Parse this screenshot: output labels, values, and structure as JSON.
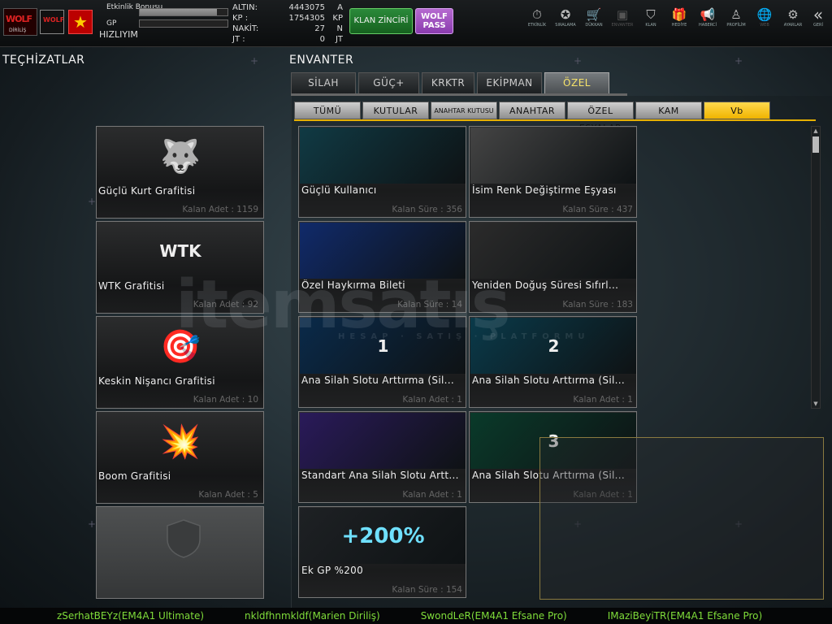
{
  "topbar": {
    "logo_text": "WOLF",
    "logo_sub": "DİRİLİŞ",
    "bonus_label": "Etkinlik Bonusu",
    "gp_label": "GP",
    "status": "HIZLIYIM",
    "bars": {
      "bonus_fill": 0.88,
      "gp_fill": 0.0
    },
    "currency": [
      {
        "label": "ALTIN:",
        "value": "4443075",
        "unit": "A"
      },
      {
        "label": "KP  :",
        "value": "1754305",
        "unit": "KP"
      },
      {
        "label": "NAKİT:",
        "value": "27",
        "unit": "N"
      },
      {
        "label": "JT  :",
        "value": "0",
        "unit": "JT"
      }
    ],
    "klan_button": "KLAN ZİNCİRİ",
    "wolf_pass": "WOLF PASS",
    "nav": [
      {
        "label": "ETKİNLİK",
        "icon": "stopwatch-icon",
        "glyph": "⏱",
        "dim": false
      },
      {
        "label": "SIRALAMA",
        "icon": "medal-icon",
        "glyph": "✪",
        "dim": false
      },
      {
        "label": "DÜKKAN",
        "icon": "cart-icon",
        "glyph": "🛒",
        "dim": false
      },
      {
        "label": "ENVANTER",
        "icon": "chest-icon",
        "glyph": "▣",
        "dim": true
      },
      {
        "label": "KLAN",
        "icon": "shield-icon",
        "glyph": "⛉",
        "dim": false
      },
      {
        "label": "HEDİYE",
        "icon": "gift-icon",
        "glyph": "🎁",
        "dim": false
      },
      {
        "label": "HABERCİ",
        "icon": "megaphone-icon",
        "glyph": "📢",
        "dim": false
      },
      {
        "label": "PROFİLİM",
        "icon": "profile-icon",
        "glyph": "♙",
        "dim": false
      },
      {
        "label": "WEB",
        "icon": "globe-icon",
        "glyph": "🌐",
        "dim": true
      },
      {
        "label": "AYARLAR",
        "icon": "gear-icon",
        "glyph": "⚙",
        "dim": false
      },
      {
        "label": "GERİ",
        "icon": "back-icon",
        "glyph": "«",
        "dim": false
      }
    ]
  },
  "left_title": "TEÇHİZATLAR",
  "right_title": "ENVANTER",
  "main_tabs": [
    {
      "label": "SİLAH",
      "active": false
    },
    {
      "label": "GÜÇ+",
      "active": false
    },
    {
      "label": "KRKTR",
      "active": false
    },
    {
      "label": "EKİPMAN",
      "active": false
    },
    {
      "label": "ÖZEL",
      "active": true
    }
  ],
  "sub_tabs": [
    {
      "label": "TÜMÜ",
      "active": false,
      "small": false
    },
    {
      "label": "KUTULAR",
      "active": false,
      "small": false
    },
    {
      "label": "ANAHTAR KUTUSU",
      "active": false,
      "small": true
    },
    {
      "label": "ANAHTAR",
      "active": false,
      "small": false
    },
    {
      "label": "ÖZEL EŞYALAR",
      "active": false,
      "small": false
    },
    {
      "label": "KAM",
      "active": false,
      "small": false
    },
    {
      "label": "Vb",
      "active": true,
      "small": false
    }
  ],
  "equipment": [
    {
      "name": "Güçlü Kurt Grafitisi",
      "sub": "Kalan Adet : 1159",
      "icon": "wolf-graffiti-icon",
      "glyph": "🐺"
    },
    {
      "name": "WTK Grafitisi",
      "sub": "Kalan Adet : 92",
      "icon": "wtk-logo-icon",
      "glyph": "WTK"
    },
    {
      "name": "Keskin Nişancı Grafitisi",
      "sub": "Kalan Adet : 10",
      "icon": "sniper-graffiti-icon",
      "glyph": "🎯"
    },
    {
      "name": "Boom Grafitisi",
      "sub": "Kalan Adet : 5",
      "icon": "boom-graffiti-icon",
      "glyph": "💥"
    }
  ],
  "empty_slot_icon": "empty-slot-shield-icon",
  "inventory_items": [
    {
      "name": "Güçlü Kullanıcı",
      "sub": "Kalan Süre : 356",
      "icon": "power-user-icon",
      "art_color": "#103a44"
    },
    {
      "name": "İsim Renk Değiştirme Eşyası",
      "sub": "Kalan Süre : 437",
      "icon": "name-color-icon",
      "art_color": "#444"
    },
    {
      "name": "Özel Haykırma Bileti",
      "sub": "Kalan Süre : 14",
      "icon": "shout-ticket-icon",
      "art_color": "#102a6a"
    },
    {
      "name": "Yeniden Doğuş Süresi Sıfırl...",
      "sub": "Kalan Süre : 183",
      "icon": "respawn-reset-icon",
      "art_color": "#2b2b2b"
    },
    {
      "name": "Ana Silah Slotu Arttırma (Sil...",
      "sub": "Kalan Adet : 1",
      "icon": "weapon-slot-1-icon",
      "art_color": "#0a2a4a",
      "badge": "1"
    },
    {
      "name": "Ana Silah Slotu Arttırma (Sil...",
      "sub": "Kalan Adet : 1",
      "icon": "weapon-slot-2-icon",
      "art_color": "#0a3a4a",
      "badge": "2"
    },
    {
      "name": "Standart Ana Silah Slotu Artt...",
      "sub": "Kalan Adet : 1",
      "icon": "weapon-slot-std-icon",
      "art_color": "#2a1a5a"
    },
    {
      "name": "Ana Silah Slotu Arttırma (Sil...",
      "sub": "Kalan Adet : 1",
      "icon": "weapon-slot-3-icon",
      "art_color": "#0a3a2a",
      "badge": "3"
    },
    {
      "name": "Ek GP %200",
      "sub": "Kalan Süre : 154",
      "icon": "gp-bonus-icon",
      "art_color": "#1e2124",
      "badge": "+200%"
    }
  ],
  "ticker": [
    "zSerhatBEYz(EM4A1 Ultimate)",
    "nkldfhnmkldf(Marien Diriliş)",
    "SwondLeR(EM4A1 Efsane Pro)",
    "IMaziBeyiTR(EM4A1 Efsane Pro)"
  ],
  "watermark": {
    "main": "itemsatış",
    "sub": "HESAP · SATIŞ · PLATFORMU"
  }
}
